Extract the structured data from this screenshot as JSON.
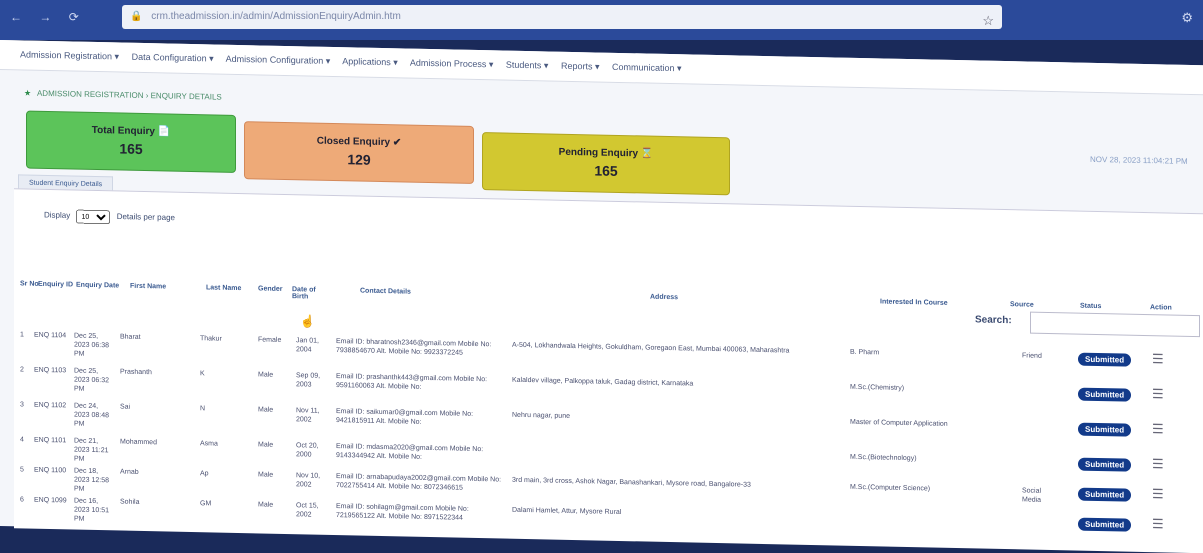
{
  "browser": {
    "url": "crm.theadmission.in/admin/AdmissionEnquiryAdmin.htm",
    "nav_back": "←",
    "nav_forward": "→",
    "nav_reload": "⟳",
    "star_icon": "star-icon",
    "extension_icon": "⚙"
  },
  "menu": [
    "Admission Registration ▾",
    "Data Configuration ▾",
    "Admission Configuration ▾",
    "Applications ▾",
    "Admission Process ▾",
    "Students ▾",
    "Reports ▾",
    "Communication ▾"
  ],
  "breadcrumb": "ADMISSION REGISTRATION › ENQUIRY DETAILS",
  "datetime": "NOV 28, 2023  11:04:21 PM",
  "cards": {
    "total": {
      "label": "Total Enquiry",
      "value": "165",
      "icon": "📄"
    },
    "closed": {
      "label": "Closed Enquiry",
      "value": "129",
      "icon": "✔"
    },
    "pending": {
      "label": "Pending Enquiry",
      "value": "165",
      "icon": "⌛"
    }
  },
  "tab_label": "Student Enquiry Details",
  "display": {
    "prefix": "Display",
    "selected": "10",
    "suffix": "Details per page"
  },
  "search_label": "Search:",
  "columns": [
    "Sr No",
    "Enquiry ID",
    "Enquiry Date",
    "First Name",
    "Last Name",
    "Gender",
    "Date of Birth",
    "Contact Details",
    "Address",
    "Interested In Course",
    "Source",
    "Status",
    "Action"
  ],
  "rows": [
    {
      "sr": "1",
      "id": "ENQ 1104",
      "date": "Dec 25, 2023 06:38 PM",
      "first": "Bharat",
      "last": "Thakur",
      "gender": "Female",
      "dob": "Jan 01, 2004",
      "contact": "Email ID: bharatnosh2346@gmail.com  Mobile No: 7938854670  Alt. Mobile No: 9923372245",
      "address": "A-504, Lokhandwala Heights, Gokuldham, Goregaon East, Mumbai 400063, Maharashtra",
      "course": "B. Pharm",
      "source": "Friend",
      "status": "Submitted"
    },
    {
      "sr": "2",
      "id": "ENQ 1103",
      "date": "Dec 25, 2023 06:32 PM",
      "first": "Prashanth",
      "last": "K",
      "gender": "Male",
      "dob": "Sep 09, 2003",
      "contact": "Email ID: prashanthk443@gmail.com  Mobile No: 9591160063  Alt. Mobile No:",
      "address": "Kalaldev village, Palkoppa taluk, Gadag district, Karnataka",
      "course": "M.Sc.(Chemistry)",
      "source": "",
      "status": "Submitted"
    },
    {
      "sr": "3",
      "id": "ENQ 1102",
      "date": "Dec 24, 2023 08:48 PM",
      "first": "Sai",
      "last": "N",
      "gender": "Male",
      "dob": "Nov 11, 2002",
      "contact": "Email ID: saikumar0@gmail.com  Mobile No: 9421815911  Alt. Mobile No:",
      "address": "Nehru nagar, pune",
      "course": "Master of Computer Application",
      "source": "",
      "status": "Submitted"
    },
    {
      "sr": "4",
      "id": "ENQ 1101",
      "date": "Dec 21, 2023 11:21 PM",
      "first": "Mohammed",
      "last": "Asma",
      "gender": "Male",
      "dob": "Oct 20, 2000",
      "contact": "Email ID: mdasma2020@gmail.com  Mobile No: 9143344942  Alt. Mobile No:",
      "address": "",
      "course": "M.Sc.(Biotechnology)",
      "source": "",
      "status": "Submitted"
    },
    {
      "sr": "5",
      "id": "ENQ 1100",
      "date": "Dec 18, 2023 12:58 PM",
      "first": "Arnab",
      "last": "Ap",
      "gender": "Male",
      "dob": "Nov 10, 2002",
      "contact": "Email ID: arnabapudaya2002@gmail.com  Mobile No: 7022755414  Alt. Mobile No: 8072346615",
      "address": "3rd main, 3rd cross, Ashok Nagar, Banashankari, Mysore road, Bangalore-33",
      "course": "M.Sc.(Computer Science)",
      "source": "Social Media",
      "status": "Submitted"
    },
    {
      "sr": "6",
      "id": "ENQ 1099",
      "date": "Dec 16, 2023 10:51 PM",
      "first": "Sohila",
      "last": "GM",
      "gender": "Male",
      "dob": "Oct 15, 2002",
      "contact": "Email ID: sohilagm@gmail.com  Mobile No: 7219565122  Alt. Mobile No: 8971522344",
      "address": "Dalami Hamlet, Attur, Mysore Rural",
      "course": "",
      "source": "",
      "status": "Submitted"
    }
  ],
  "colors": {
    "green": "#5cc45a",
    "orange": "#eeaa78",
    "yellow": "#d2c830",
    "badge": "#123a8a"
  }
}
